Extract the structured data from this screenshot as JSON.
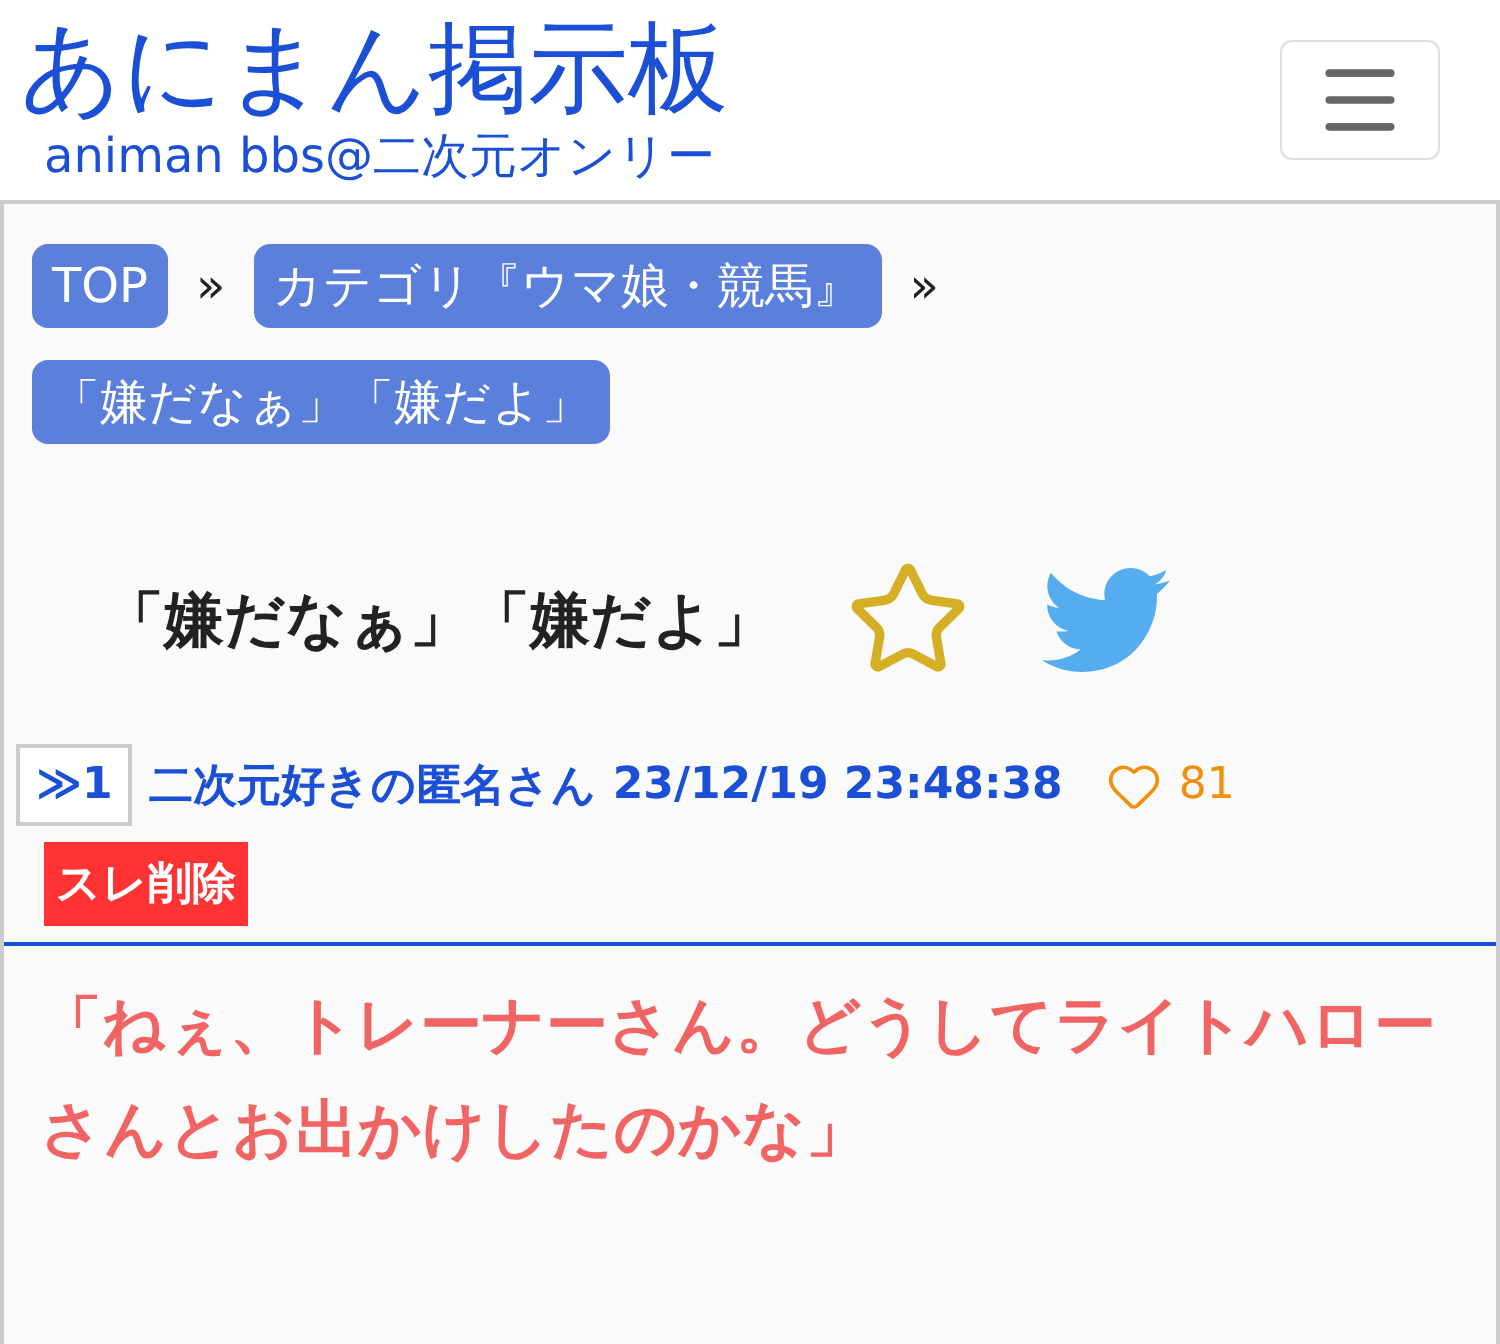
{
  "header": {
    "title": "あにまん掲示板",
    "subtitle": "animan bbs@二次元オンリー"
  },
  "breadcrumbs": [
    {
      "label": "TOP"
    },
    {
      "label": "カテゴリ『ウマ娘・競馬』"
    },
    {
      "label": "「嫌だなぁ」「嫌だよ」"
    }
  ],
  "breadcrumb_separator": "»",
  "thread": {
    "title": "「嫌だなぁ」「嫌だよ」"
  },
  "post": {
    "number": "≫1",
    "author": "二次元好きの匿名さん",
    "date": "23/12/19 23:48:38",
    "likes": "81",
    "delete_label": "スレ削除",
    "body": "「ねぇ、トレーナーさん。どうしてライトハローさんとお出かけしたのかな」"
  }
}
